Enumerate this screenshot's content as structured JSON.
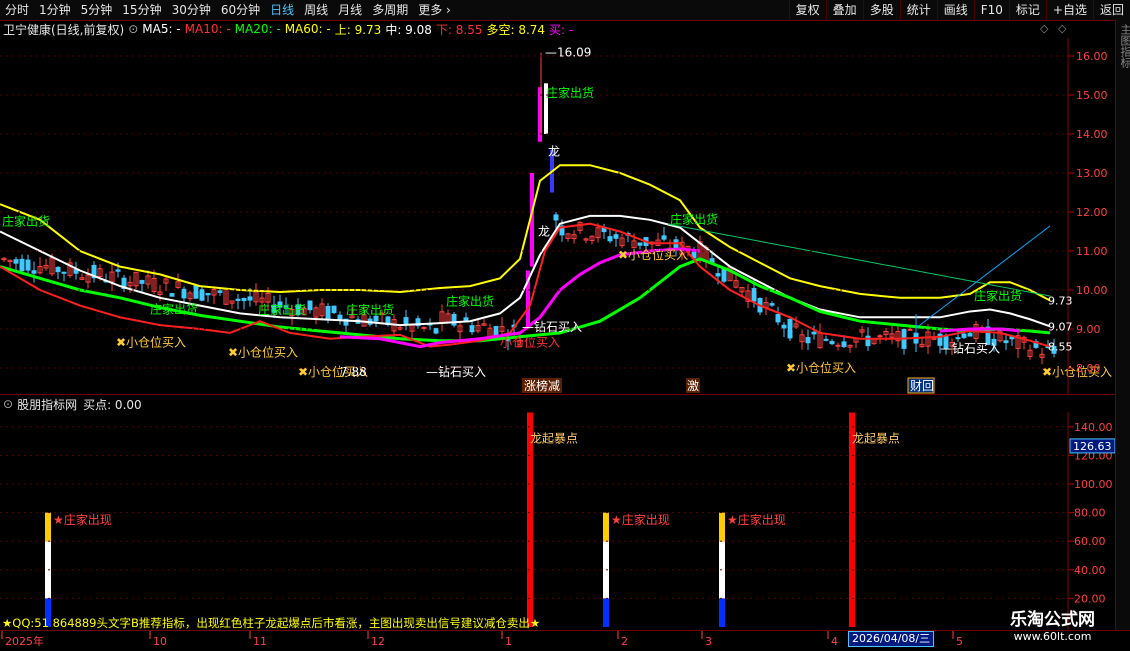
{
  "toolbar": {
    "timeframes": [
      "分时",
      "1分钟",
      "5分钟",
      "15分钟",
      "30分钟",
      "60分钟",
      "日线",
      "周线",
      "月线",
      "多周期",
      "更多"
    ],
    "active_index": 6,
    "right_buttons": [
      "复权",
      "叠加",
      "多股",
      "统计",
      "画线",
      "F10",
      "标记",
      "+自选",
      "返回"
    ]
  },
  "info": {
    "stock": "卫宁健康(日线,前复权)",
    "ma5": "MA5: -",
    "ma10": "MA10: -",
    "ma20": "MA20: -",
    "ma60": "MA60: -",
    "up": "上: 9.73",
    "mid": "中: 9.08",
    "down": "下: 8.55",
    "duokong": "多空: 8.74",
    "buy": "买: -",
    "colors": {
      "ma5": "#ffffff",
      "ma10": "#ff3030",
      "ma20": "#00ff00",
      "ma60": "#ffff00",
      "up": "#ffff00",
      "mid": "#ffffff",
      "down": "#ff3030",
      "duokong": "#ffff00",
      "buy": "#ff00ff"
    }
  },
  "indicator": {
    "title": "股朋指标网",
    "value": "买点: 0.00"
  },
  "price_axis": {
    "ticks": [
      "16.09",
      "16.00",
      "15.00",
      "14.00",
      "13.00",
      "12.00",
      "11.00",
      "10.00",
      "9.00",
      "8.00"
    ],
    "tags": [
      "9.73",
      "9.07",
      "8.55"
    ]
  },
  "indicator_axis": {
    "ticks": [
      "140.00",
      "120.00",
      "100.00",
      "80.00",
      "60.00",
      "40.00",
      "20.00"
    ],
    "highlight": "126.63"
  },
  "chart_labels": {
    "top_low": "7.88",
    "peak": "16.09",
    "zhuangjia_chuhuo": "庄家出货",
    "xiaocang_mairu": "小仓位买入",
    "zuanshi_mairu": "钻石买入",
    "long": "龙",
    "longqi": "龙起暴点",
    "zhuangjia_chuxian": "庄家出现",
    "events": [
      "涨榜减",
      "激",
      "财回"
    ]
  },
  "bottom_note": "★QQ:51 864889头文字B推荐指标，出现红色柱子龙起爆点后市看涨，主图出现卖出信号建议减仓卖出★",
  "date_axis": [
    "2025年",
    "10",
    "11",
    "12",
    "1",
    "2",
    "3",
    "4",
    "5"
  ],
  "date_highlight": "2026/04/08/三",
  "watermark": {
    "line1": "乐淘公式网",
    "line2": "www.60lt.com"
  },
  "right_panel": "主图指标"
}
